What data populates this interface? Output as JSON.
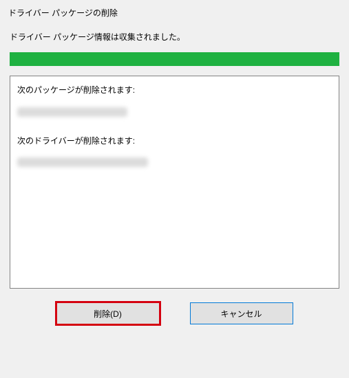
{
  "dialog": {
    "title": "ドライバー パッケージの削除",
    "status_message": "ドライバー パッケージ情報は収集されました。",
    "progress_percent": 100
  },
  "content": {
    "packages_label": "次のパッケージが削除されます:",
    "drivers_label": "次のドライバーが削除されます:"
  },
  "buttons": {
    "delete_label": "削除(D)",
    "cancel_label": "キャンセル"
  },
  "colors": {
    "progress_fill": "#1fb141",
    "highlight_border": "#d4000f",
    "focus_border": "#0078d7"
  }
}
